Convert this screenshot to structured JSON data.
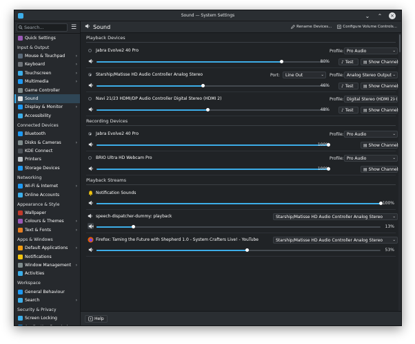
{
  "window": {
    "title": "Sound — System Settings"
  },
  "sidebar": {
    "search_placeholder": "Search...",
    "quick_settings": "Quick Settings",
    "categories": [
      {
        "label": "Input & Output",
        "items": [
          {
            "label": "Mouse & Touchpad",
            "icon": "mouse-icon",
            "color": "#5b6b7a",
            "chevron": true
          },
          {
            "label": "Keyboard",
            "icon": "keyboard-icon",
            "color": "#6e7379",
            "chevron": true
          },
          {
            "label": "Touchscreen",
            "icon": "touchscreen-icon",
            "color": "#3daee9",
            "chevron": true
          },
          {
            "label": "Multimedia",
            "icon": "multimedia-icon",
            "color": "#1d99f3",
            "chevron": true
          },
          {
            "label": "Game Controller",
            "icon": "gamepad-icon",
            "color": "#7f8c8d",
            "chevron": false
          },
          {
            "label": "Sound",
            "icon": "speaker-icon",
            "color": "#dfe1e3",
            "chevron": false,
            "active": true
          },
          {
            "label": "Display & Monitor",
            "icon": "monitor-icon",
            "color": "#1d99f3",
            "chevron": true
          },
          {
            "label": "Accessibility",
            "icon": "accessibility-icon",
            "color": "#3daee9",
            "chevron": false
          }
        ]
      },
      {
        "label": "Connected Devices",
        "items": [
          {
            "label": "Bluetooth",
            "icon": "bluetooth-icon",
            "color": "#1d99f3",
            "chevron": false
          },
          {
            "label": "Disks & Cameras",
            "icon": "disk-icon",
            "color": "#7f8c8d",
            "chevron": true
          },
          {
            "label": "KDE Connect",
            "icon": "kde-connect-icon",
            "color": "#4d5359",
            "chevron": false
          },
          {
            "label": "Printers",
            "icon": "printer-icon",
            "color": "#bdc3c7",
            "chevron": false
          },
          {
            "label": "Storage Devices",
            "icon": "storage-icon",
            "color": "#1d99f3",
            "chevron": false
          }
        ]
      },
      {
        "label": "Networking",
        "items": [
          {
            "label": "Wi-Fi & Internet",
            "icon": "wifi-icon",
            "color": "#1d99f3",
            "chevron": true
          },
          {
            "label": "Online Accounts",
            "icon": "accounts-icon",
            "color": "#3daee9",
            "chevron": false
          }
        ]
      },
      {
        "label": "Appearance & Style",
        "items": [
          {
            "label": "Wallpaper",
            "icon": "wallpaper-icon",
            "color": "#c0392b",
            "chevron": false
          },
          {
            "label": "Colours & Themes",
            "icon": "themes-icon",
            "color": "#9b59b6",
            "chevron": true
          },
          {
            "label": "Text & Fonts",
            "icon": "fonts-icon",
            "color": "#e67e22",
            "chevron": true
          }
        ]
      },
      {
        "label": "Apps & Windows",
        "items": [
          {
            "label": "Default Applications",
            "icon": "default-apps-icon",
            "color": "#f39c12",
            "chevron": true
          },
          {
            "label": "Notifications",
            "icon": "bell-icon",
            "color": "#f1c40f",
            "chevron": false
          },
          {
            "label": "Window Management",
            "icon": "window-icon",
            "color": "#7f8c8d",
            "chevron": true
          },
          {
            "label": "Activities",
            "icon": "activities-icon",
            "color": "#3daee9",
            "chevron": false
          }
        ]
      },
      {
        "label": "Workspace",
        "items": [
          {
            "label": "General Behaviour",
            "icon": "general-icon",
            "color": "#1d99f3",
            "chevron": false
          },
          {
            "label": "Search",
            "icon": "search-icon",
            "color": "#3daee9",
            "chevron": true
          }
        ]
      },
      {
        "label": "Security & Privacy",
        "items": [
          {
            "label": "Screen Locking",
            "icon": "lock-icon",
            "color": "#3daee9",
            "chevron": false
          },
          {
            "label": "Application Permissions",
            "icon": "permissions-icon",
            "color": "#1d99f3",
            "chevron": false
          }
        ]
      }
    ]
  },
  "header": {
    "title": "Sound",
    "rename_label": "Rename Devices...",
    "configure_label": "Configure Volume Controls..."
  },
  "playback": {
    "section": "Playback Devices",
    "devices": [
      {
        "name": "Jabra Evolve2 40 Pro",
        "default": false,
        "volume": 80,
        "volume_label": "80%",
        "profile": "Pro Audio",
        "port": null,
        "test": "Test",
        "channels": "Show Channels"
      },
      {
        "name": "Starship/Matisse HD Audio Controller Analog Stereo",
        "default": true,
        "volume": 46,
        "volume_label": "46%",
        "profile": "Analog Stereo Output",
        "port": "Line Out",
        "test": "Test",
        "channels": "Show Channels"
      },
      {
        "name": "Navi 21/23 HDMI/DP Audio Controller Digital Stereo (HDMI 2)",
        "default": false,
        "volume": 48,
        "volume_label": "48%",
        "profile": "Digital Stereo (HDMI 2) O",
        "port": null,
        "test": "Test",
        "channels": "Show Channels"
      }
    ]
  },
  "recording": {
    "section": "Recording Devices",
    "devices": [
      {
        "name": "Jabra Evolve2 40 Pro",
        "default": true,
        "volume": 100,
        "volume_label": "100%",
        "profile": "Pro Audio",
        "channels": "Show Channels"
      },
      {
        "name": "BRIO Ultra HD Webcam Pro",
        "default": false,
        "volume": 100,
        "volume_label": "100%",
        "profile": "Pro Audio",
        "channels": "Show Channels"
      }
    ]
  },
  "streams": {
    "section": "Playback Streams",
    "items": [
      {
        "name": "Notification Sounds",
        "icon": "bell-icon",
        "volume": 100,
        "volume_label": "100%",
        "device": null,
        "muted": false
      },
      {
        "name": "speech-dispatcher-dummy: playback",
        "icon": "speaker-icon",
        "volume": 13,
        "volume_label": "13%",
        "device": "Starship/Matisse HD Audio Controller Analog Stereo",
        "muted": true
      },
      {
        "name": "Firefox: Taming the Future with Shepherd 1.0 - System Crafters Live! - YouTube",
        "icon": "firefox-icon",
        "volume": 53,
        "volume_label": "53%",
        "device": "Starship/Matisse HD Audio Controller Analog Stereo",
        "muted": false
      }
    ]
  },
  "labels": {
    "profile": "Profile:",
    "port": "Port:"
  },
  "footer": {
    "help": "Help"
  },
  "colors": {
    "accent": "#3daee9",
    "window_bg": "#202326",
    "sidebar_bg": "#26292d"
  }
}
